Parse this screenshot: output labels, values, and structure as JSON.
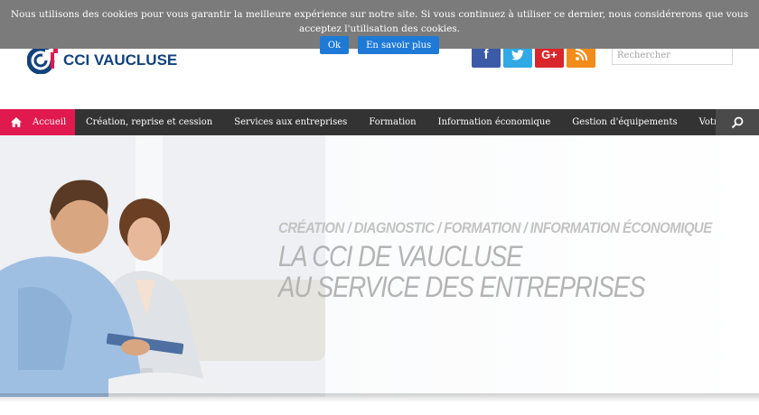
{
  "cookie": {
    "text": "Nous utilisons des cookies pour vous garantir la meilleure expérience sur notre site. Si vous continuez à utiliser ce dernier, nous considérerons que vous acceptez l'utilisation des cookies.",
    "ok_label": "Ok",
    "more_label": "En savoir plus"
  },
  "header": {
    "logo_text": "CCI VAUCLUSE",
    "search_placeholder": "Rechercher",
    "social": [
      {
        "icon": "facebook-icon",
        "glyph": "f",
        "color": "#3b5ba9"
      },
      {
        "icon": "twitter-icon",
        "glyph": "t",
        "color": "#30a9e4"
      },
      {
        "icon": "google-plus-icon",
        "glyph": "G+",
        "color": "#d9262b"
      },
      {
        "icon": "rss-icon",
        "glyph": "rss",
        "color": "#f28c1b"
      }
    ]
  },
  "nav": {
    "home_label": "Accueil",
    "items": [
      "Création, reprise et cession",
      "Services aux entreprises",
      "Formation",
      "Information économique",
      "Gestion d'équipements",
      "Votre CCI"
    ],
    "accent": "#e0194f"
  },
  "hero": {
    "subtitle": "CRÉATION / DIAGNOSTIC / FORMATION / INFORMATION ÉCONOMIQUE",
    "title_line1": "LA CCI DE VAUCLUSE",
    "title_line2": "AU SERVICE DES ENTREPRISES"
  }
}
